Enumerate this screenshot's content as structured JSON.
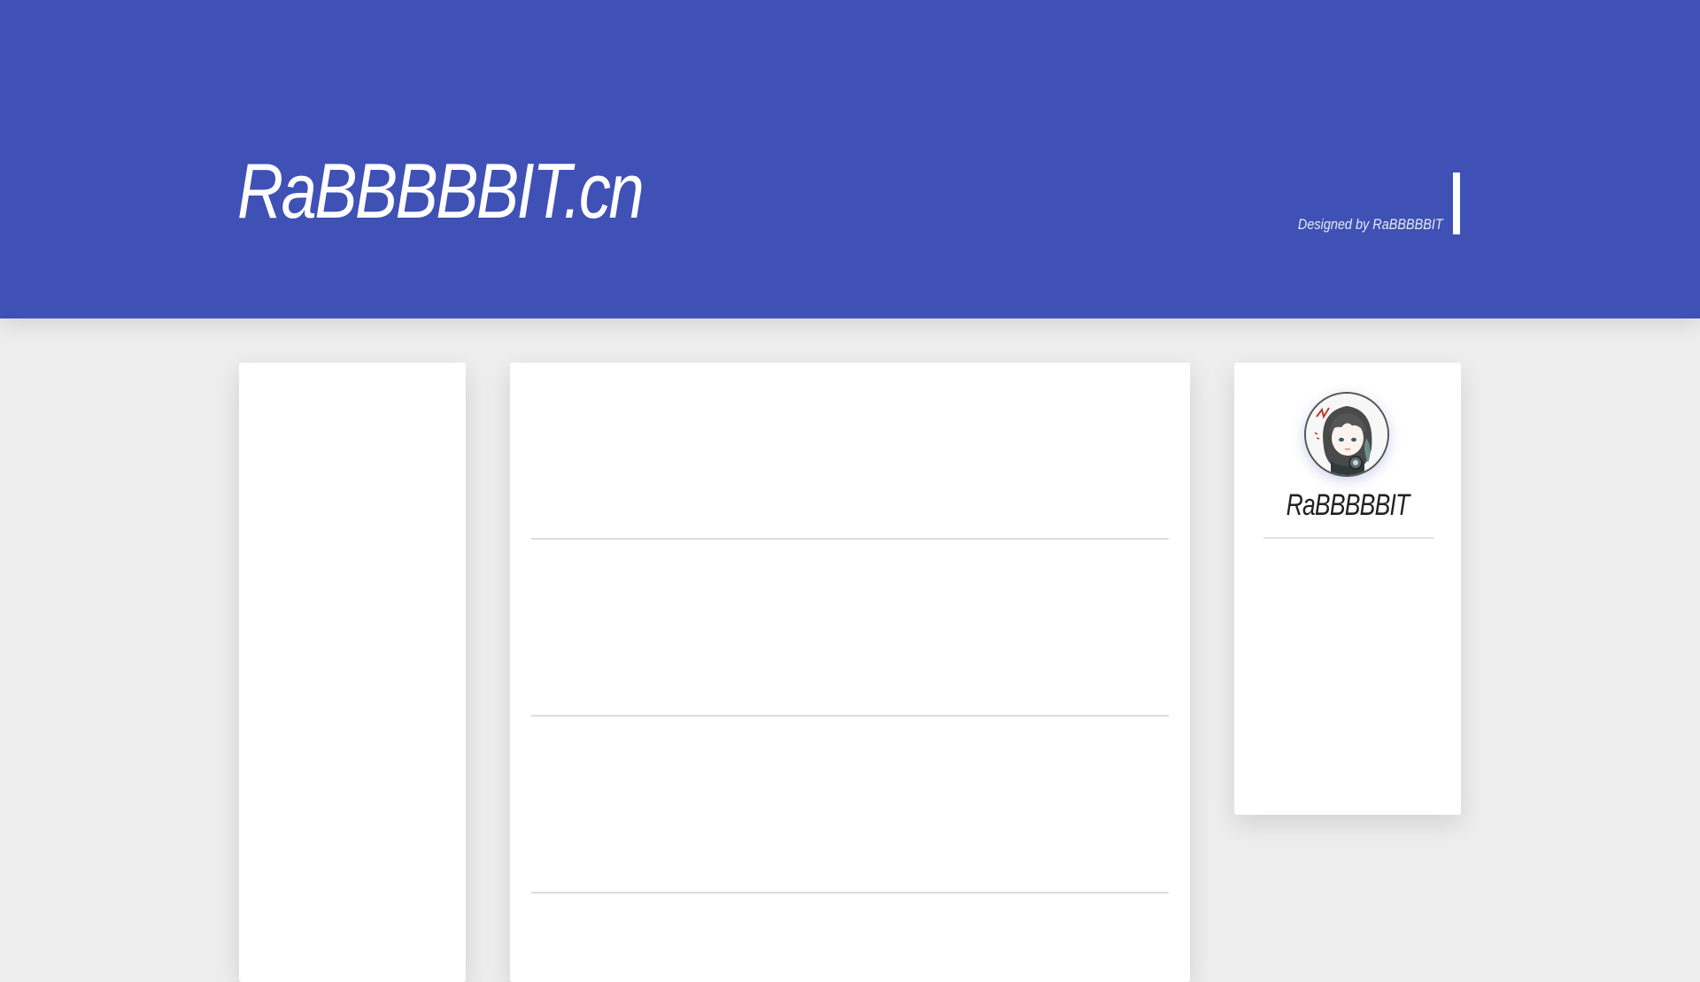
{
  "header": {
    "site_title": "RaBBBBBIT.cn",
    "designed_by": "Designed by RaBBBBBIT",
    "background_color": "#3f51b5"
  },
  "profile": {
    "name": "RaBBBBBIT",
    "avatar_icon": "anime-character-avatar"
  },
  "colors": {
    "page_background": "#eeeeee",
    "panel_background": "#ffffff",
    "accent": "#3f51b5"
  }
}
